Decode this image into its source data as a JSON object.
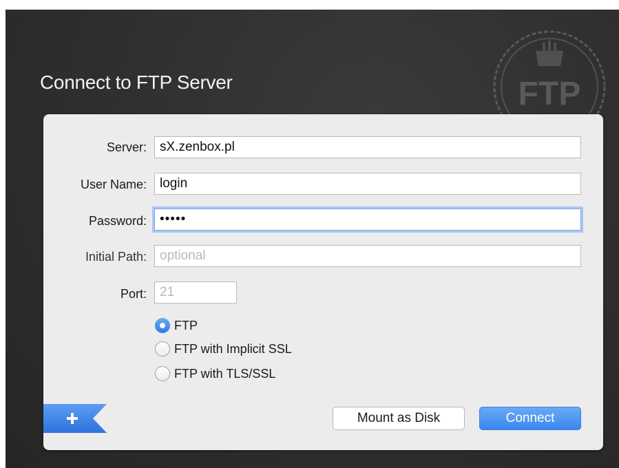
{
  "dialog": {
    "title": "Connect to FTP Server",
    "logo_text": "FTP"
  },
  "form": {
    "server": {
      "label": "Server:",
      "value": "sX.zenbox.pl"
    },
    "username": {
      "label": "User Name:",
      "value": "login"
    },
    "password": {
      "label": "Password:",
      "value": "•••••"
    },
    "initial_path": {
      "label": "Initial Path:",
      "value": "",
      "placeholder": "optional"
    },
    "port": {
      "label": "Port:",
      "value": "",
      "placeholder": "21"
    }
  },
  "protocols": [
    {
      "label": "FTP",
      "selected": true
    },
    {
      "label": "FTP with Implicit SSL",
      "selected": false
    },
    {
      "label": "FTP with TLS/SSL",
      "selected": false
    }
  ],
  "buttons": {
    "add_icon": "plus-icon",
    "mount": "Mount as Disk",
    "connect": "Connect"
  },
  "colors": {
    "accent": "#3a86f0",
    "background": "#2e2e2e",
    "panel": "#ececec"
  }
}
